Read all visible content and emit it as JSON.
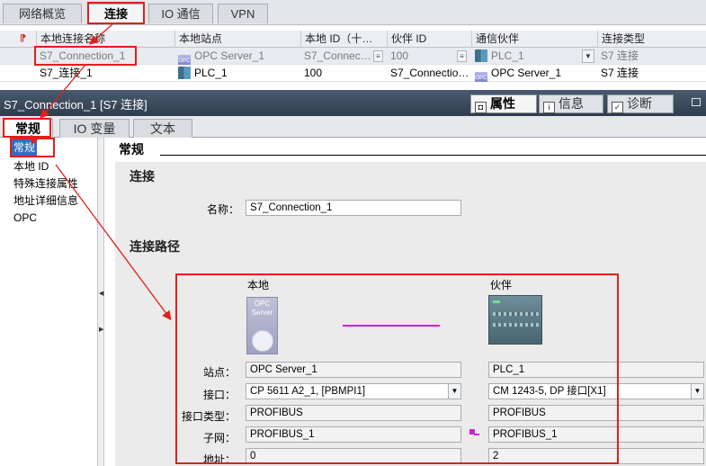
{
  "top_tabs": [
    {
      "label": "网络概览"
    },
    {
      "label": "连接"
    },
    {
      "label": "IO 通信"
    },
    {
      "label": "VPN"
    }
  ],
  "table": {
    "headers": [
      "本地连接名称",
      "本地站点",
      "本地 ID（十…",
      "伙伴 ID",
      "通信伙伴",
      "连接类型"
    ],
    "rows": [
      {
        "name": "S7_Connection_1",
        "station": "OPC Server_1",
        "local_id": "S7_Connec…",
        "partner_id": "100",
        "partner": "PLC_1",
        "type": "S7 连接"
      },
      {
        "name": "S7_连接_1",
        "station": "PLC_1",
        "local_id": "100",
        "partner_id": "S7_Connectio…",
        "partner": "OPC Server_1",
        "type": "S7 连接"
      }
    ]
  },
  "inspector": {
    "title": "S7_Connection_1 [S7 连接]",
    "right_tabs": [
      {
        "label": "属性",
        "icon": "properties-icon"
      },
      {
        "label": "信息",
        "icon": "info-icon"
      },
      {
        "label": "诊断",
        "icon": "diagnostics-icon"
      }
    ],
    "sub_tabs": [
      {
        "label": "常规"
      },
      {
        "label": "IO 变量"
      },
      {
        "label": "文本"
      }
    ]
  },
  "nav": {
    "items": [
      {
        "label": "常规"
      },
      {
        "label": "本地 ID"
      },
      {
        "label": "特殊连接属性"
      },
      {
        "label": "地址详细信息"
      },
      {
        "label": "OPC"
      }
    ]
  },
  "general": {
    "heading": "常规",
    "connection_section": "连接",
    "name_label": "名称：",
    "name_value": "S7_Connection_1",
    "path_section": "连接路径",
    "local_title": "本地",
    "partner_title": "伙伴",
    "opc_device_text": "OPC Server",
    "labels": {
      "station": "站点：",
      "interface": "接口：",
      "interface_type": "接口类型：",
      "subnet": "子网：",
      "address": "地址："
    },
    "local": {
      "station": "OPC Server_1",
      "interface": "CP 5611 A2_1, [PBMPI1]",
      "interface_type": "PROFIBUS",
      "subnet": "PROFIBUS_1",
      "address": "0"
    },
    "partner": {
      "station": "PLC_1",
      "interface": "CM 1243-5, DP 接口[X1]",
      "interface_type": "PROFIBUS",
      "subnet": "PROFIBUS_1",
      "address": "2"
    }
  },
  "colors": {
    "annotation": "#e0201b",
    "link_line": "#d21fd2",
    "nav_selection": "#2f6fc1"
  }
}
